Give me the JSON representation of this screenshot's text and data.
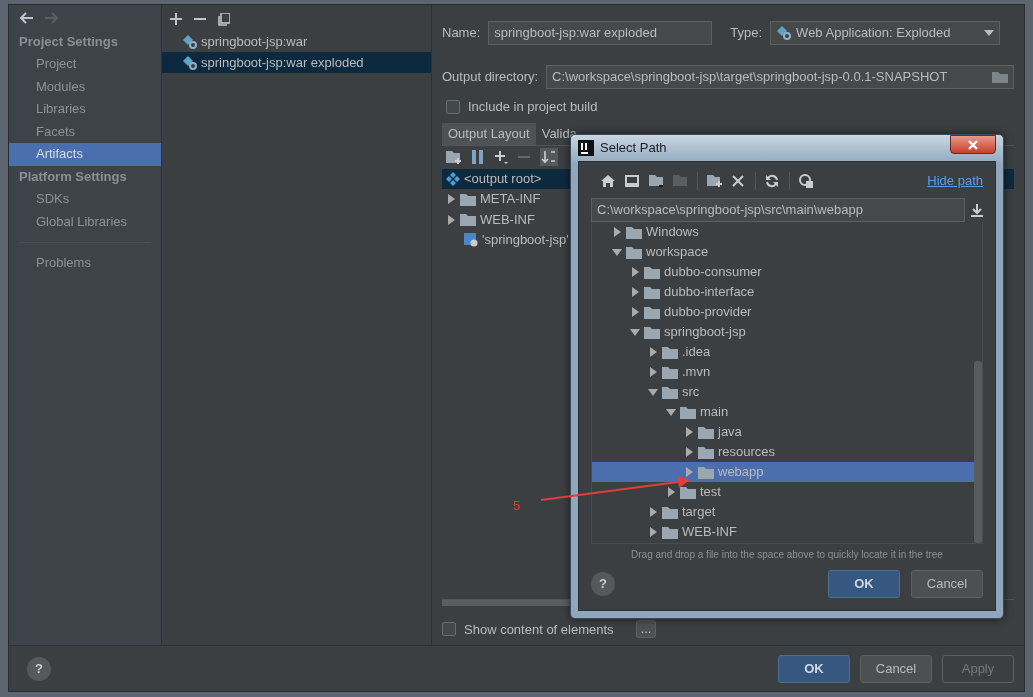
{
  "nav_buttons": [
    {
      "kind": "back",
      "disabled": false
    },
    {
      "kind": "forward",
      "disabled": true
    }
  ],
  "sidebar": {
    "sections": [
      {
        "title": "Project Settings",
        "items": [
          {
            "label": "Project",
            "selected": false
          },
          {
            "label": "Modules",
            "selected": false
          },
          {
            "label": "Libraries",
            "selected": false
          },
          {
            "label": "Facets",
            "selected": false
          },
          {
            "label": "Artifacts",
            "selected": true
          }
        ]
      },
      {
        "title": "Platform Settings",
        "items": [
          {
            "label": "SDKs",
            "selected": false
          },
          {
            "label": "Global Libraries",
            "selected": false
          }
        ]
      }
    ],
    "problems": {
      "label": "Problems",
      "selected": false
    }
  },
  "artifacts": [
    {
      "label": "springboot-jsp:war",
      "selected": false
    },
    {
      "label": "springboot-jsp:war exploded",
      "selected": true
    }
  ],
  "details": {
    "name_label": "Name:",
    "name_value": "springboot-jsp:war exploded",
    "type_label": "Type:",
    "type_value": "Web Application: Exploded",
    "output_label": "Output directory:",
    "output_value": "C:\\workspace\\springboot-jsp\\target\\springboot-jsp-0.0.1-SNAPSHOT",
    "include_checkbox": {
      "label": "Include in project build",
      "checked": false
    },
    "tabs": [
      {
        "label": "Output Layout",
        "selected": true
      },
      {
        "label": "Valida",
        "selected": false
      }
    ],
    "layout_tree": [
      {
        "label": "<output root>",
        "kind": "root",
        "selected": true
      },
      {
        "label": "META-INF",
        "kind": "folder",
        "expanded": false,
        "selected": false
      },
      {
        "label": "WEB-INF",
        "kind": "folder",
        "expanded": false,
        "selected": false
      },
      {
        "label": "'springboot-jsp'",
        "kind": "module",
        "selected": false
      }
    ],
    "show_content_checkbox": {
      "label": "Show content of elements",
      "checked": false
    },
    "more_button": "..."
  },
  "footer": {
    "help": "?",
    "buttons": [
      {
        "label": "OK",
        "kind": "primary",
        "disabled": false
      },
      {
        "label": "Cancel",
        "kind": "default",
        "disabled": false
      },
      {
        "label": "Apply",
        "kind": "default",
        "disabled": true
      }
    ]
  },
  "dialog": {
    "title": "Select Path",
    "hide_path": "Hide path",
    "path": "C:\\workspace\\springboot-jsp\\src\\main\\webapp",
    "tree": [
      {
        "label": "Windows",
        "expanded": false,
        "selected": false
      },
      {
        "label": "workspace",
        "expanded": true,
        "selected": false,
        "children": [
          {
            "label": "dubbo-consumer",
            "expanded": false,
            "selected": false
          },
          {
            "label": "dubbo-interface",
            "expanded": false,
            "selected": false
          },
          {
            "label": "dubbo-provider",
            "expanded": false,
            "selected": false
          },
          {
            "label": "springboot-jsp",
            "expanded": true,
            "selected": false,
            "children": [
              {
                "label": ".idea",
                "expanded": false,
                "selected": false
              },
              {
                "label": ".mvn",
                "expanded": false,
                "selected": false
              },
              {
                "label": "src",
                "expanded": true,
                "selected": false,
                "children": [
                  {
                    "label": "main",
                    "expanded": true,
                    "selected": false,
                    "children": [
                      {
                        "label": "java",
                        "expanded": false,
                        "selected": false
                      },
                      {
                        "label": "resources",
                        "expanded": false,
                        "selected": false
                      },
                      {
                        "label": "webapp",
                        "expanded": false,
                        "selected": true
                      }
                    ]
                  },
                  {
                    "label": "test",
                    "expanded": false,
                    "selected": false
                  }
                ]
              },
              {
                "label": "target",
                "expanded": false,
                "selected": false
              },
              {
                "label": "WEB-INF",
                "expanded": false,
                "selected": false
              }
            ]
          }
        ]
      }
    ],
    "hint": "Drag and drop a file into the space above to quickly locate it in the tree",
    "help": "?",
    "buttons": [
      {
        "label": "OK",
        "kind": "primary"
      },
      {
        "label": "Cancel",
        "kind": "default"
      }
    ]
  },
  "annotation": {
    "label": "5"
  }
}
